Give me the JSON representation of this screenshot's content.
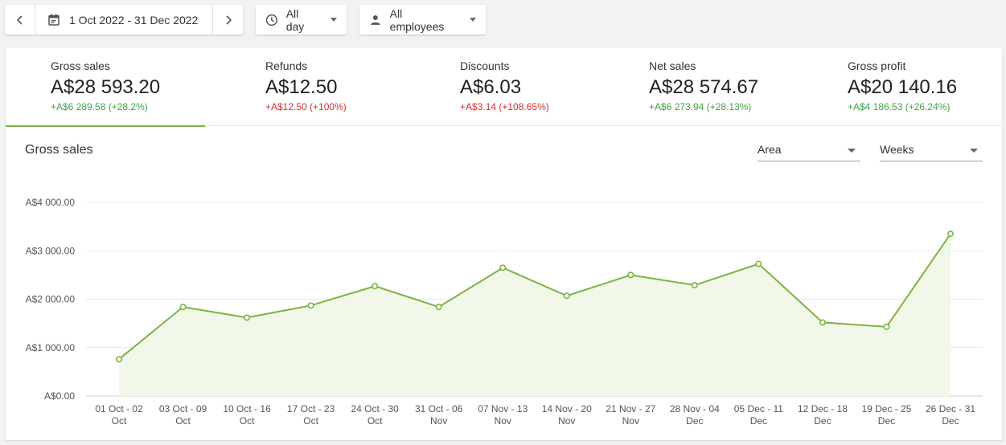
{
  "toolbar": {
    "date_range": "1 Oct 2022 - 31 Dec 2022",
    "time_filter": "All day",
    "employee_filter": "All employees"
  },
  "metrics": [
    {
      "label": "Gross sales",
      "value": "A$28 593.20",
      "change": "+A$6 289.58 (+28.2%)",
      "trend": "positive",
      "active": true
    },
    {
      "label": "Refunds",
      "value": "A$12.50",
      "change": "+A$12.50 (+100%)",
      "trend": "negative",
      "active": false
    },
    {
      "label": "Discounts",
      "value": "A$6.03",
      "change": "+A$3.14 (+108.65%)",
      "trend": "negative",
      "active": false
    },
    {
      "label": "Net sales",
      "value": "A$28 574.67",
      "change": "+A$6 273.94 (+28.13%)",
      "trend": "positive",
      "active": false
    },
    {
      "label": "Gross profit",
      "value": "A$20 140.16",
      "change": "+A$4 186.53 (+26.24%)",
      "trend": "positive",
      "active": false
    }
  ],
  "chart_panel": {
    "title": "Gross sales",
    "chart_type_select": "Area",
    "period_select": "Weeks"
  },
  "colors": {
    "accent": "#7cb342",
    "area_fill": "#f1f8e9",
    "positive": "#43a047",
    "negative": "#d32f2f"
  },
  "chart_data": {
    "type": "area",
    "title": "Gross sales",
    "categories": [
      [
        "01 Oct - 02",
        "Oct"
      ],
      [
        "03 Oct - 09",
        "Oct"
      ],
      [
        "10 Oct - 16",
        "Oct"
      ],
      [
        "17 Oct - 23",
        "Oct"
      ],
      [
        "24 Oct - 30",
        "Oct"
      ],
      [
        "31 Oct - 06",
        "Nov"
      ],
      [
        "07 Nov - 13",
        "Nov"
      ],
      [
        "14 Nov - 20",
        "Nov"
      ],
      [
        "21 Nov - 27",
        "Nov"
      ],
      [
        "28 Nov - 04",
        "Dec"
      ],
      [
        "05 Dec - 11",
        "Dec"
      ],
      [
        "12 Dec - 18",
        "Dec"
      ],
      [
        "19 Dec - 25",
        "Dec"
      ],
      [
        "26 Dec - 31",
        "Dec"
      ]
    ],
    "values": [
      760,
      1840,
      1620,
      1870,
      2270,
      1840,
      2650,
      2070,
      2500,
      2290,
      2730,
      1520,
      1430,
      3350
    ],
    "ylim": [
      0,
      4000
    ],
    "yticks": [
      {
        "value": 0,
        "label": "A$0.00"
      },
      {
        "value": 1000,
        "label": "A$1 000.00"
      },
      {
        "value": 2000,
        "label": "A$2 000.00"
      },
      {
        "value": 3000,
        "label": "A$3 000.00"
      },
      {
        "value": 4000,
        "label": "A$4 000.00"
      }
    ],
    "grid": true
  }
}
